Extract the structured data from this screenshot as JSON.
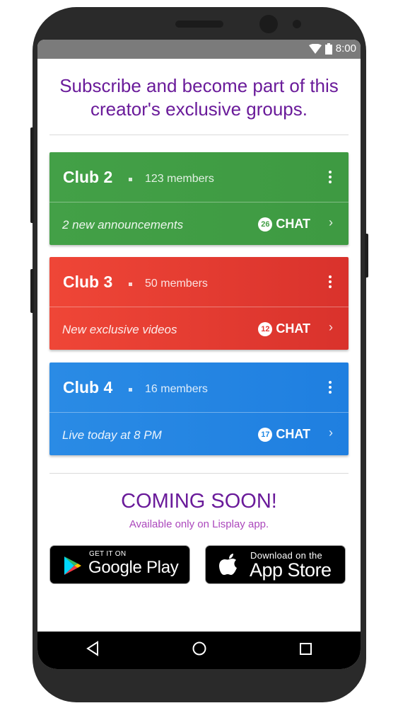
{
  "status_bar": {
    "time": "8:00"
  },
  "headline": "Subscribe and become part of this creator's exclusive groups.",
  "clubs": [
    {
      "name": "Club 2",
      "members": "123 members",
      "note": "2 new announcements",
      "chat_count": "26",
      "chat_label": "CHAT",
      "color": "#43a047"
    },
    {
      "name": "Club 3",
      "members": "50 members",
      "note": "New exclusive videos",
      "chat_count": "12",
      "chat_label": "CHAT",
      "color": "#e53935"
    },
    {
      "name": "Club 4",
      "members": "16 members",
      "note": "Live today at 8 PM",
      "chat_count": "17",
      "chat_label": "CHAT",
      "color": "#1e88e5"
    }
  ],
  "coming_soon": {
    "title": "COMING SOON!",
    "subtitle": "Available only on Lisplay app."
  },
  "stores": {
    "google": {
      "small": "GET IT ON",
      "big": "Google Play"
    },
    "apple": {
      "small": "Download on the",
      "big": "App Store"
    }
  },
  "nav": {
    "back_icon": "triangle-back-icon",
    "home_icon": "circle-home-icon",
    "recents_icon": "square-recents-icon"
  }
}
